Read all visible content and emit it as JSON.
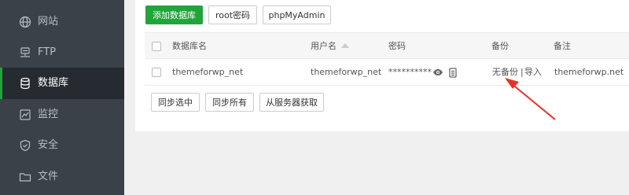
{
  "sidebar": {
    "items": [
      {
        "label": "网站",
        "icon": "globe-icon"
      },
      {
        "label": "FTP",
        "icon": "ftp-server-icon"
      },
      {
        "label": "数据库",
        "icon": "database-icon",
        "active": true
      },
      {
        "label": "监控",
        "icon": "monitor-chart-icon"
      },
      {
        "label": "安全",
        "icon": "shield-icon"
      },
      {
        "label": "文件",
        "icon": "folder-icon"
      }
    ]
  },
  "toolbar": {
    "add_db": "添加数据库",
    "root_pwd": "root密码",
    "phpmyadmin": "phpMyAdmin"
  },
  "table": {
    "headers": {
      "name": "数据库名",
      "user": "用户名",
      "password": "密码",
      "backup": "备份",
      "memo": "备注"
    },
    "rows": [
      {
        "name": "themeforwp_net",
        "user": "themeforwp_net",
        "password": "**********",
        "backup": "无备份",
        "separator": "|",
        "import": "导入",
        "memo": "themeforwp.net"
      }
    ]
  },
  "actions": {
    "sync_selected": "同步选中",
    "sync_all": "同步所有",
    "fetch_from_server": "从服务器获取"
  },
  "colors": {
    "accent": "#20a53a",
    "sidebar": "#3a4149",
    "sidebar_active": "#262b31",
    "annotation": "#e8322a"
  }
}
